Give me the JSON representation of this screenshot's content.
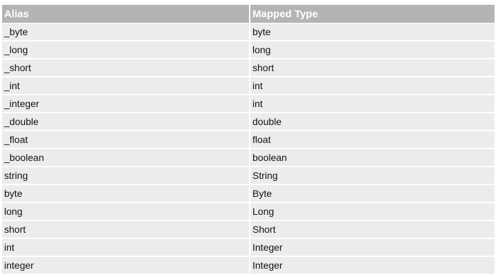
{
  "table": {
    "headers": [
      "Alias",
      "Mapped Type"
    ],
    "rows": [
      [
        "_byte",
        "byte"
      ],
      [
        "_long",
        "long"
      ],
      [
        "_short",
        "short"
      ],
      [
        "_int",
        "int"
      ],
      [
        "_integer",
        "int"
      ],
      [
        "_double",
        "double"
      ],
      [
        "_float",
        "float"
      ],
      [
        "_boolean",
        "boolean"
      ],
      [
        "string",
        "String"
      ],
      [
        "byte",
        "Byte"
      ],
      [
        "long",
        "Long"
      ],
      [
        "short",
        "Short"
      ],
      [
        "int",
        "Integer"
      ],
      [
        "integer",
        "Integer"
      ]
    ]
  }
}
